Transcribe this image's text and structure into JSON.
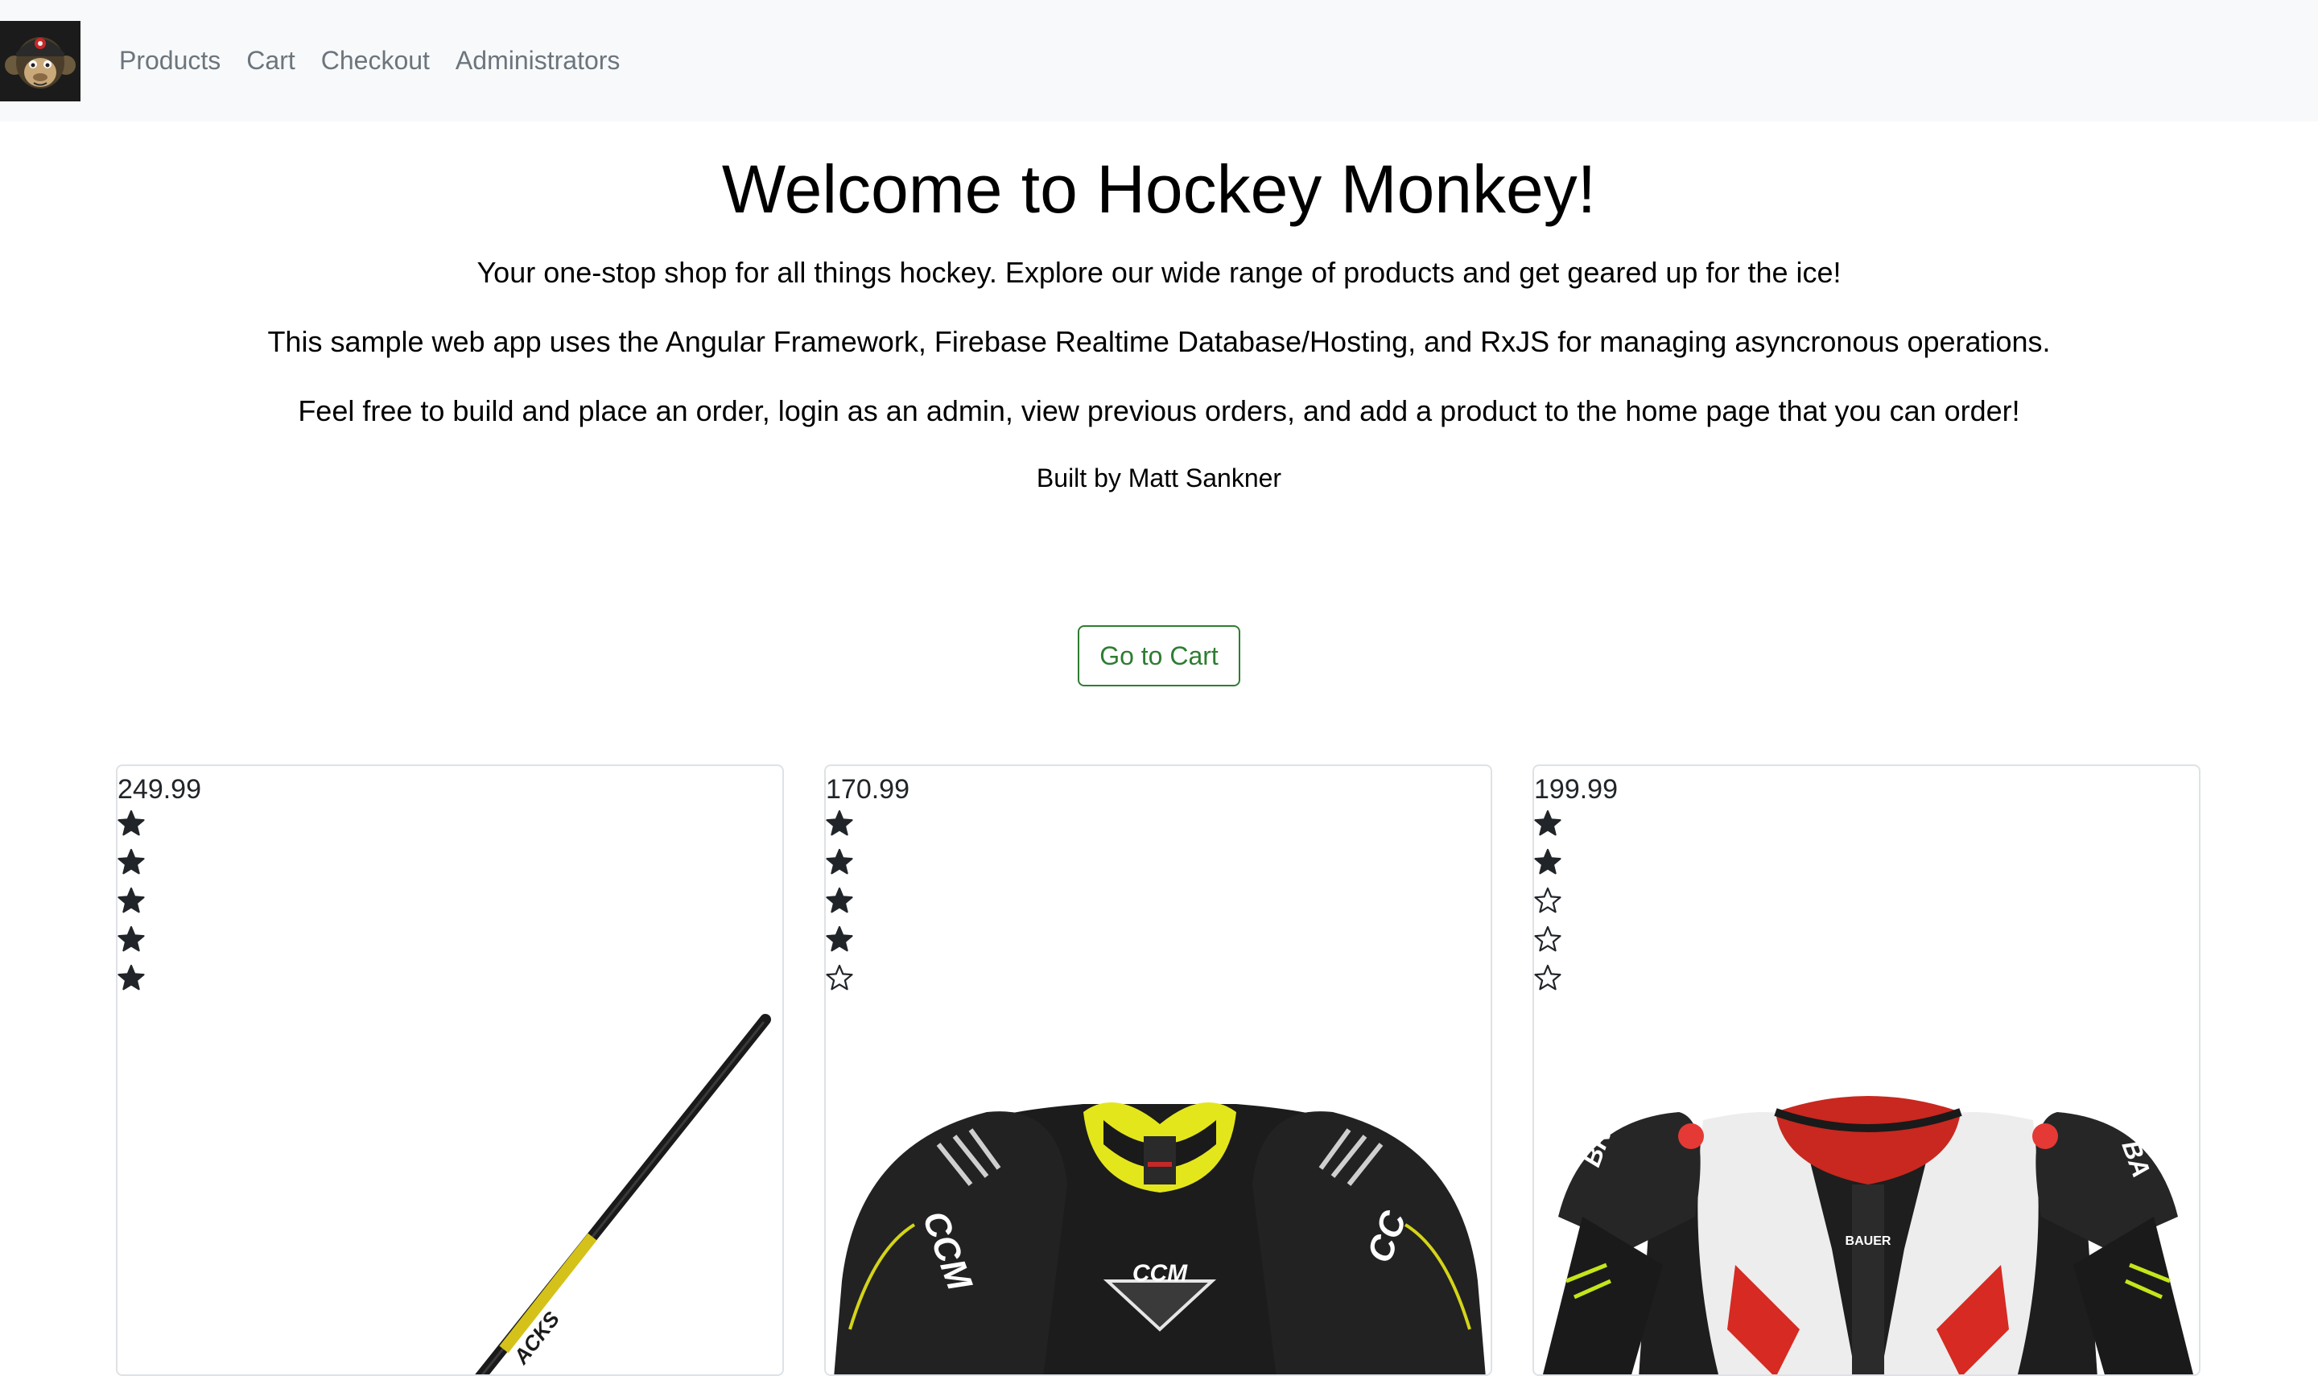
{
  "nav": {
    "logo_name": "monkey-logo",
    "links": [
      {
        "label": "Products"
      },
      {
        "label": "Cart"
      },
      {
        "label": "Checkout"
      },
      {
        "label": "Administrators"
      }
    ]
  },
  "hero": {
    "title": "Welcome to Hockey Monkey!",
    "p1": "Your one-stop shop for all things hockey. Explore our wide range of products and get geared up for the ice!",
    "p2": "This sample web app uses the Angular Framework, Firebase Realtime Database/Hosting, and RxJS for managing asyncronous operations.",
    "p3": "Feel free to build and place an order, login as an admin, view previous orders, and add a product to the home page that you can order!",
    "p4": "Built by Matt Sankner"
  },
  "cart_button": {
    "label": "Go to Cart"
  },
  "products": [
    {
      "price": "249.99",
      "rating": 5,
      "image": "hockey-stick-image"
    },
    {
      "price": "170.99",
      "rating": 4,
      "image": "ccm-shoulder-pads-image"
    },
    {
      "price": "199.99",
      "rating": 2,
      "image": "bauer-shoulder-pads-image"
    }
  ],
  "colors": {
    "navbar_bg": "#f8f9fa",
    "nav_link": "#6c757d",
    "button_accent": "#2e7d32",
    "star": "#212529"
  }
}
